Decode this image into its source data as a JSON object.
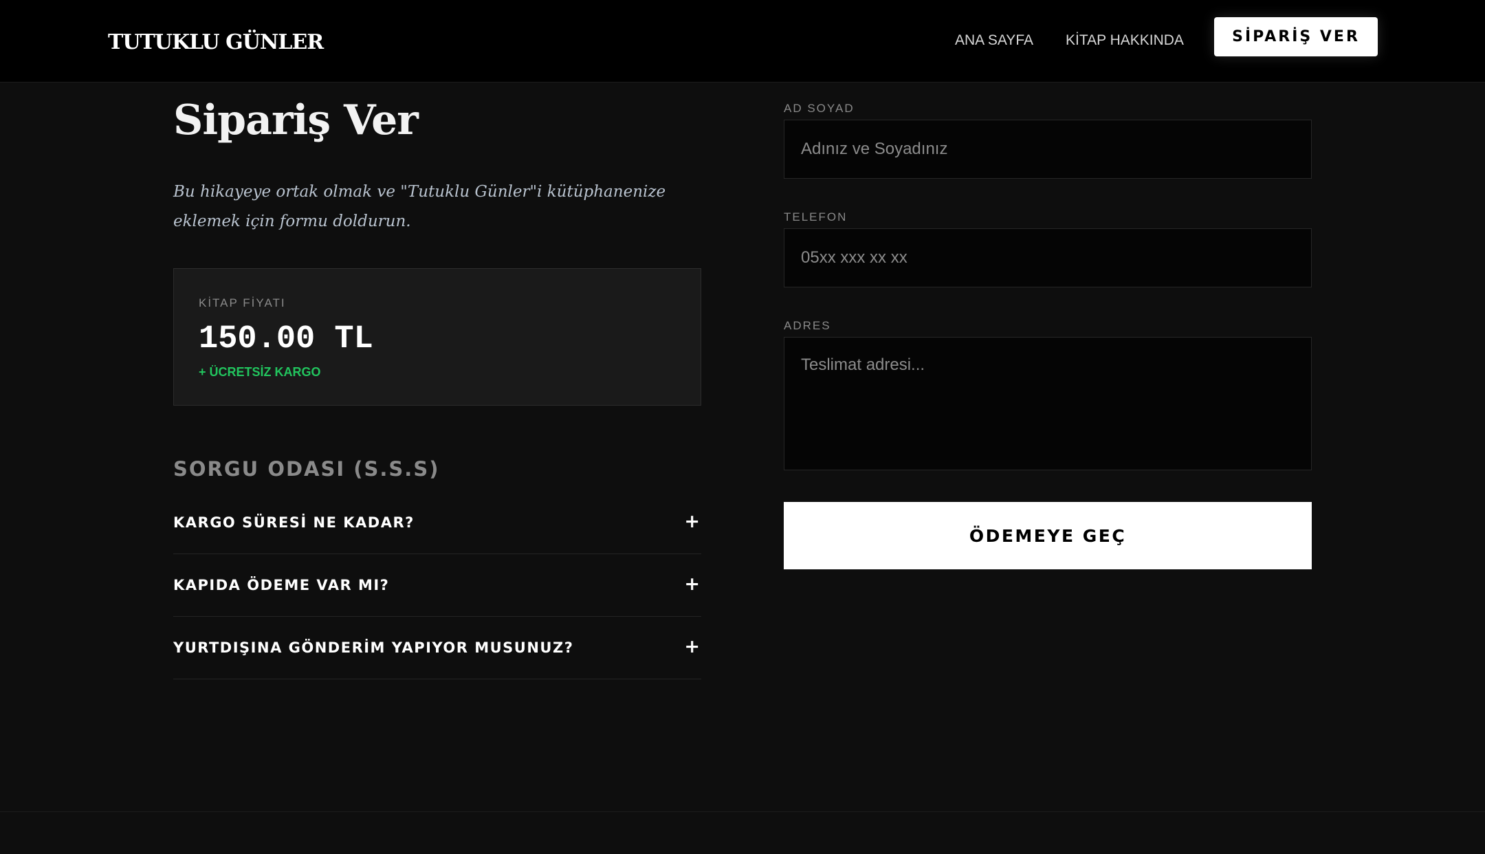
{
  "header": {
    "logo": "TUTUKLU GÜNLER",
    "nav": {
      "home": "ANA SAYFA",
      "about": "KİTAP HAKKINDA",
      "order": "SİPARİŞ VER"
    }
  },
  "main": {
    "title": "Sipariş Ver",
    "subtitle": "Bu hikayeye ortak olmak ve \"Tutuklu Günler\"i kütüphanenize eklemek için formu doldurun.",
    "price_card": {
      "label": "KİTAP FİYATI",
      "value": "150.00 TL",
      "shipping": "+ ÜCRETSİZ KARGO"
    },
    "faq": {
      "title": "SORGU ODASI (S.S.S)",
      "items": [
        {
          "question": "KARGO SÜRESİ NE KADAR?",
          "toggle": "+"
        },
        {
          "question": "KAPIDA ÖDEME VAR MI?",
          "toggle": "+"
        },
        {
          "question": "YURTDIŞINA GÖNDERİM YAPIYOR MUSUNUZ?",
          "toggle": "+"
        }
      ]
    }
  },
  "form": {
    "name": {
      "label": "AD SOYAD",
      "placeholder": "Adınız ve Soyadınız",
      "value": ""
    },
    "phone": {
      "label": "TELEFON",
      "placeholder": "05xx xxx xx xx",
      "value": ""
    },
    "address": {
      "label": "ADRES",
      "placeholder": "Teslimat adresi...",
      "value": ""
    },
    "submit_label": "ÖDEMEYE GEÇ"
  },
  "colors": {
    "background": "#0e0e0e",
    "header_bg": "#000000",
    "card_bg": "#1a1a1a",
    "accent_green": "#22c55e",
    "muted_text": "#8a8a8a",
    "subtitle_text": "#b9c3cf"
  },
  "icons": {
    "faq_toggle": "plus-icon"
  }
}
